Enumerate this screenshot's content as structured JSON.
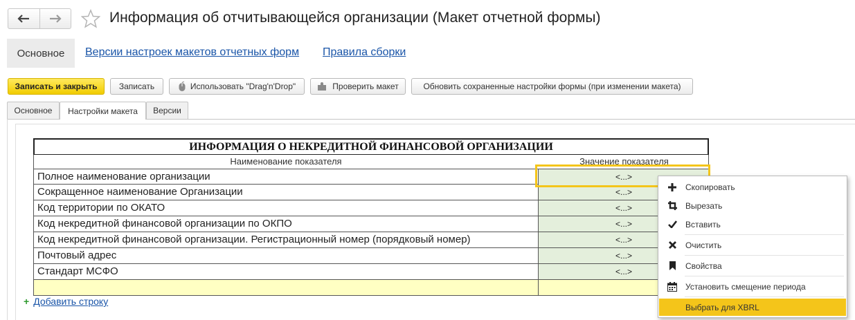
{
  "header": {
    "back_icon": "arrow-left-icon",
    "forward_icon": "arrow-right-icon",
    "favorite_icon": "star-icon",
    "title": "Информация об отчитывающейся организации (Макет отчетной формы)"
  },
  "panel_tabs": {
    "active": "Основное",
    "links": [
      "Версии настроек макетов отчетных форм",
      "Правила сборки"
    ]
  },
  "toolbar": {
    "save_close": "Записать и закрыть",
    "save": "Записать",
    "dragdrop": "Использовать \"Drag'n'Drop\"",
    "check": "Проверить макет",
    "refresh": "Обновить сохраненные настройки формы (при изменении макета)"
  },
  "inner_tabs": [
    "Основное",
    "Настройки макета",
    "Версии"
  ],
  "sheet": {
    "title": "ИНФОРМАЦИЯ О НЕКРЕДИТНОЙ ФИНАНСОВОЙ ОРГАНИЗАЦИИ",
    "col_name": "Наименование показателя",
    "col_value": "Значение показателя",
    "rows": [
      {
        "name": "Полное наименование организации",
        "value": "<...>"
      },
      {
        "name": "Сокращенное наименование Организации",
        "value": "<...>"
      },
      {
        "name": "Код территории по ОКАТО",
        "value": "<...>"
      },
      {
        "name": "Код некредитной финансовой организации по ОКПО",
        "value": "<...>"
      },
      {
        "name": "Код некредитной финансовой организации. Регистрационный номер (порядковый номер)",
        "value": "<...>"
      },
      {
        "name": "Почтовый адрес",
        "value": "<...>"
      },
      {
        "name": "Стандарт МСФО",
        "value": "<...>"
      },
      {
        "name": "",
        "value": ""
      }
    ]
  },
  "add_row": "Добавить строку",
  "context_menu": {
    "items": [
      {
        "label": "Скопировать",
        "icon": "plus-icon"
      },
      {
        "label": "Вырезать",
        "icon": "crop-icon"
      },
      {
        "label": "Вставить",
        "icon": "checkmark-icon"
      },
      {
        "label": "Очистить",
        "icon": "close-x-icon"
      },
      {
        "label": "Свойства",
        "icon": "bookmark-icon"
      },
      {
        "label": "Установить смещение периода",
        "icon": "calendar-icon"
      },
      {
        "label": "Выбрать для XBRL",
        "icon": ""
      }
    ],
    "highlight_color": "#f4c51a"
  },
  "colors": {
    "primary_button": "#f1cc00",
    "value_cell": "#e4efdc",
    "empty_row": "#ffffc3",
    "link": "#1a55a8"
  }
}
